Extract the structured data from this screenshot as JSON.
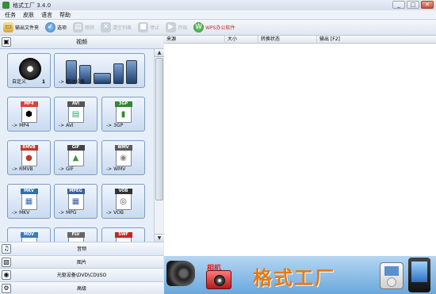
{
  "window": {
    "title": "格式工厂 3.4.0",
    "min": "_",
    "max": "□",
    "close": "✕"
  },
  "menu": [
    "任务",
    "皮肤",
    "语言",
    "帮助"
  ],
  "toolbar": {
    "output_folder": "输出文件夹",
    "options": "选项",
    "remove": "移除",
    "clear_list": "清空列表",
    "stop": "停止",
    "start": "开始",
    "wps": "WPS办公软件"
  },
  "left": {
    "category": "视频",
    "tiles": [
      {
        "label": "自定义",
        "badge": "1"
      },
      {
        "label": "-> 移动设备"
      },
      {
        "label": "-> MP4",
        "tag": "MP4",
        "color": "#d9443a"
      },
      {
        "label": "-> AVI",
        "tag": "AVI",
        "color": "#555555"
      },
      {
        "label": "-> 3GP",
        "tag": "3GP",
        "color": "#2f8a2f"
      },
      {
        "label": "-> RMVB",
        "tag": "RMVB",
        "color": "#c0392b"
      },
      {
        "label": "-> GIF",
        "tag": "GIF",
        "color": "#444444"
      },
      {
        "label": "-> WMV",
        "tag": "WMV",
        "color": "#5a5a5a"
      },
      {
        "label": "-> MKV",
        "tag": "MKV",
        "color": "#2f6fb0"
      },
      {
        "label": "-> MPG",
        "tag": "MPEG",
        "color": "#3a5fa0"
      },
      {
        "label": "-> VOB",
        "tag": "VOB",
        "color": "#333333"
      },
      {
        "label": "",
        "tag": "MOV",
        "color": "#3a7ac0"
      },
      {
        "label": "",
        "tag": "FLV",
        "color": "#666666"
      },
      {
        "label": "",
        "tag": "SWF",
        "color": "#cc2222"
      }
    ],
    "bottom_categories": [
      "音频",
      "图片",
      "光驱设备\\DVD\\CD\\ISO",
      "高级"
    ]
  },
  "table": {
    "headers": [
      "来源",
      "大小",
      "转换状态",
      "输出 [F2]"
    ]
  },
  "banner": {
    "title": "格式工厂",
    "red_text": "相机"
  }
}
